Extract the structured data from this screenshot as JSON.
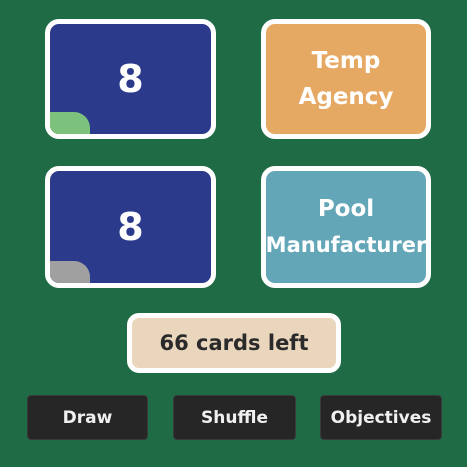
{
  "cards": [
    {
      "value": "8",
      "indicator_color": "#7cc27c"
    },
    {
      "name_line1": "Temp",
      "name_line2": "Agency",
      "color": "#e6a964"
    },
    {
      "value": "8",
      "indicator_color": "#a0a0a0"
    },
    {
      "name_line1": "Pool",
      "name_line2": "Manufacturer",
      "color": "#62a6b8"
    }
  ],
  "deck": {
    "counter_text": "66 cards left"
  },
  "controls": {
    "draw_label": "Draw",
    "shuffle_label": "Shuffle",
    "objectives_label": "Objectives"
  },
  "colors": {
    "table": "#1e6b45",
    "number_card": "#2b3a8a",
    "card_border": "#ffffff",
    "counter_bg": "#ead6bd",
    "button_bg": "#262626"
  }
}
